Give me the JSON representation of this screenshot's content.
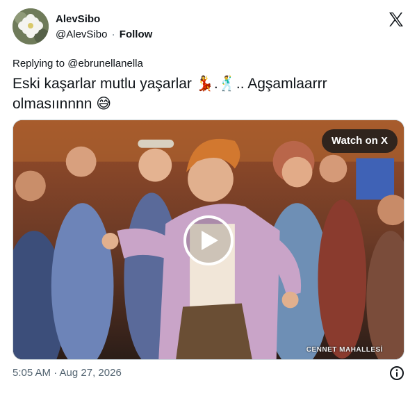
{
  "author": {
    "display_name": "AlevSibo",
    "handle": "@AlevSibo",
    "separator": "·",
    "follow_label": "Follow"
  },
  "reply": {
    "prefix": "Replying to",
    "target": "@ebrunellanella"
  },
  "tweet": {
    "text_line1": "Eski kaşarlar mutlu yaşarlar 💃.🕺.. Agşamlaarrr",
    "text_line2": "olmasıınnnn 😅"
  },
  "media": {
    "watch_label": "Watch on X",
    "watermark": "CENNET MAHALLESİ"
  },
  "footer": {
    "timestamp": "5:05 AM · Aug 27, 2026"
  },
  "icons": {
    "logo": "x-logo-icon",
    "play": "play-icon",
    "info": "info-icon"
  }
}
